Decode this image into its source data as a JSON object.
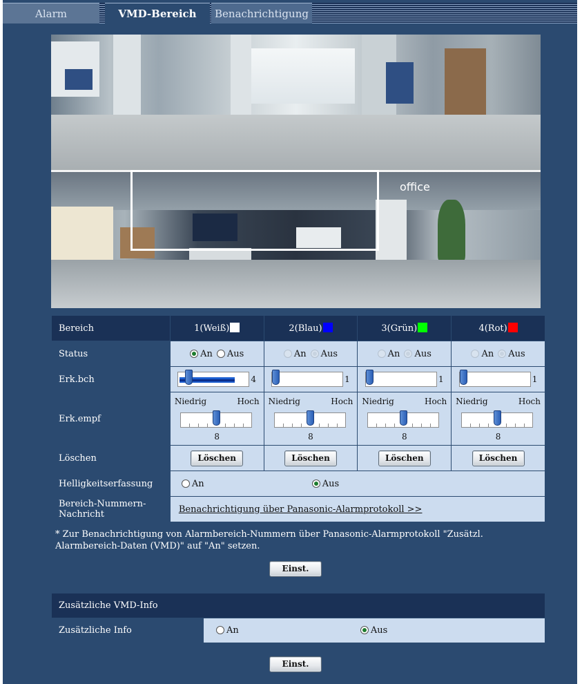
{
  "tabs": [
    {
      "label": "Alarm",
      "active": false
    },
    {
      "label": "VMD-Bereich",
      "active": true
    },
    {
      "label": "Benachrichtigung",
      "active": false
    }
  ],
  "camera_overlay": {
    "sign_text": "office"
  },
  "areas": {
    "row_label": "Bereich",
    "items": [
      {
        "label": "1(Weiß)",
        "color": "#ffffff"
      },
      {
        "label": "2(Blau)",
        "color": "#0000ff"
      },
      {
        "label": "3(Grün)",
        "color": "#00ff00"
      },
      {
        "label": "4(Rot)",
        "color": "#ff0000"
      }
    ]
  },
  "status": {
    "label": "Status",
    "on_label": "An",
    "off_label": "Aus",
    "values": [
      "An",
      "Aus",
      "Aus",
      "Aus"
    ]
  },
  "detection_size": {
    "label": "Erk.bch",
    "values": [
      "4",
      "1",
      "1",
      "1"
    ]
  },
  "sensitivity": {
    "label": "Erk.empf",
    "low_label": "Niedrig",
    "high_label": "Hoch",
    "values": [
      "8",
      "8",
      "8",
      "8"
    ]
  },
  "delete": {
    "label": "Löschen",
    "button_label": "Löschen"
  },
  "brightness": {
    "label": "Helligkeitserfassung",
    "on_label": "An",
    "off_label": "Aus",
    "selected": "Aus"
  },
  "area_number_message": {
    "label": "Bereich-Nummern-Nachricht",
    "link_text": "Benachrichtigung über Panasonic-Alarmprotokoll >>"
  },
  "note": "* Zur Benachrichtigung von Alarmbereich-Nummern über Panasonic-Alarmprotokoll \"Zusätzl. Alarmbereich-Daten (VMD)\" auf \"An\" setzen.",
  "set_button": "Einst.",
  "extra_info": {
    "section_title": "Zusätzliche VMD-Info",
    "label": "Zusätzliche Info",
    "on_label": "An",
    "off_label": "Aus",
    "selected": "Aus"
  },
  "set_button_2": "Einst."
}
